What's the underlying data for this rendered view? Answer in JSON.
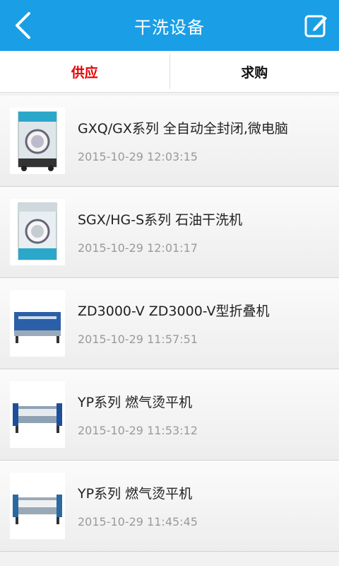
{
  "header": {
    "title": "干洗设备"
  },
  "tabs": [
    {
      "label": "供应",
      "active": true
    },
    {
      "label": "求购",
      "active": false
    }
  ],
  "items": [
    {
      "title": "GXQ/GX系列 全自动全封闭,微电脑",
      "time": "2015-10-29 12:03:15",
      "image": "dry-cleaning-machine"
    },
    {
      "title": "SGX/HG-S系列 石油干洗机",
      "time": "2015-10-29 12:01:17",
      "image": "dry-cleaning-machine"
    },
    {
      "title": "ZD3000-V ZD3000-V型折叠机",
      "time": "2015-10-29 11:57:51",
      "image": "folding-machine"
    },
    {
      "title": "YP系列 燃气烫平机",
      "time": "2015-10-29 11:53:12",
      "image": "ironing-machine"
    },
    {
      "title": "YP系列 燃气烫平机",
      "time": "2015-10-29 11:45:45",
      "image": "ironing-machine"
    }
  ],
  "colors": {
    "header": "#1a9ee6",
    "active_tab": "#e60000"
  }
}
